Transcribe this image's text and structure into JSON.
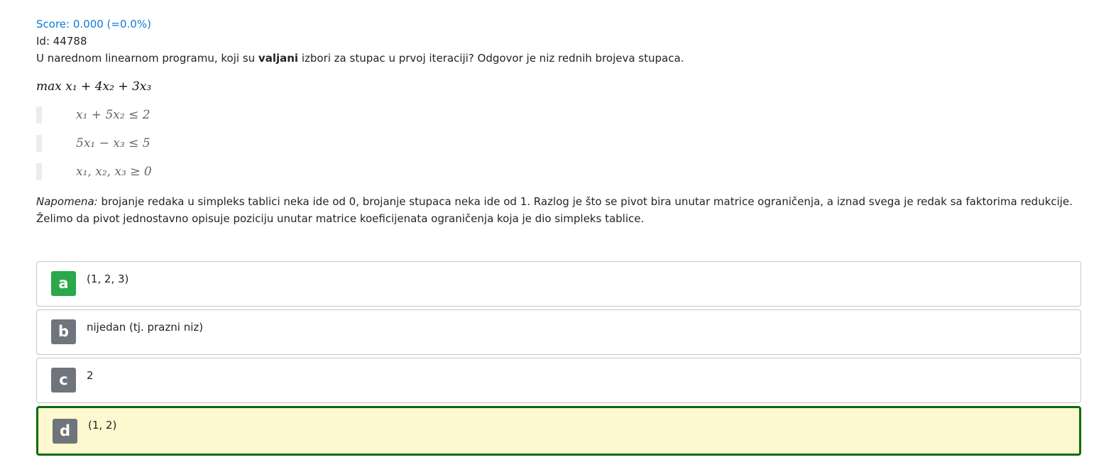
{
  "score": "Score: 0.000 (=0.0%)",
  "question_id": "Id: 44788",
  "question": {
    "before": "U narednom linearnom programu, koji su ",
    "bold": "valjani",
    "after": " izbori za stupac u prvoj iteraciji? Odgovor je niz rednih brojeva stupaca."
  },
  "lp": {
    "objective": "max x₁ + 4x₂ + 3x₃",
    "constraints": [
      "x₁ + 5x₂ ≤ 2",
      "5x₁ − x₃ ≤ 5",
      "x₁, x₂, x₃ ≥ 0"
    ]
  },
  "note": {
    "label": "Napomena:",
    "text": " brojanje redaka u simpleks tablici neka ide od 0, brojanje stupaca neka ide od 1. Razlog je što se pivot bira unutar matrice ograničenja, a iznad svega je redak sa faktorima redukcije. Želimo da pivot jednostavno opisuje poziciju unutar matrice koeficijenata ograničenja koja je dio simpleks tablice."
  },
  "options": [
    {
      "letter": "a",
      "text": "(1, 2, 3)",
      "badge_color": "#2aa84a",
      "selected": false
    },
    {
      "letter": "b",
      "text": "nijedan (tj. prazni niz)",
      "badge_color": "#6f757b",
      "selected": false
    },
    {
      "letter": "c",
      "text": "2",
      "badge_color": "#6f757b",
      "selected": false
    },
    {
      "letter": "d",
      "text": "(1, 2)",
      "badge_color": "#6f757b",
      "selected": true
    }
  ],
  "colors": {
    "score_link": "#0d7bd8",
    "selected_border": "#0d6b0d",
    "selected_background": "#fdf8cf"
  }
}
